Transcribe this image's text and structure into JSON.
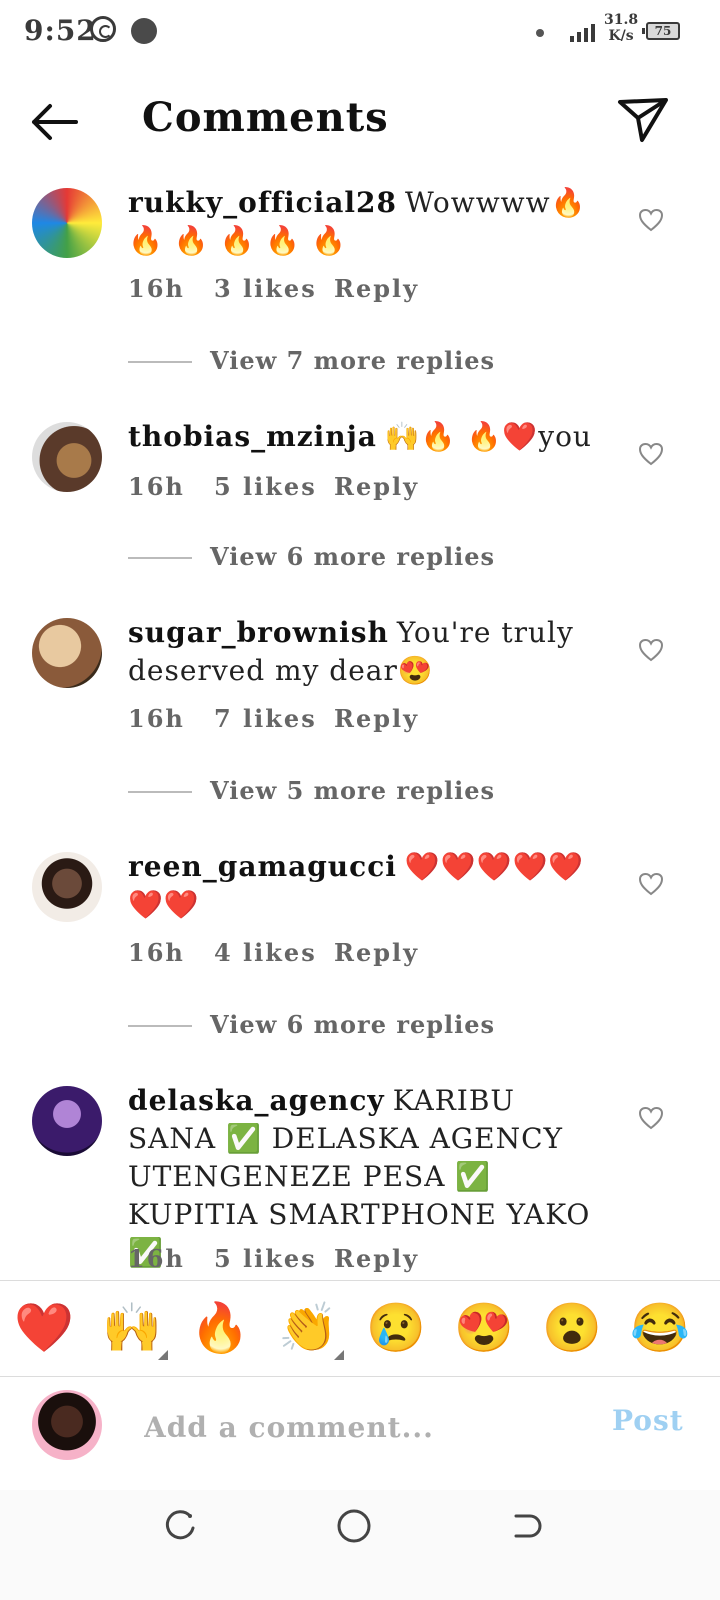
{
  "status_bar": {
    "time": "9:52",
    "speed_value": "31.8",
    "speed_unit": "K/s",
    "battery": "75"
  },
  "header": {
    "title": "Comments"
  },
  "comments": [
    {
      "username": "rukky_official28",
      "text": "Wowwww🔥 🔥 🔥 🔥 🔥 🔥",
      "time": "16h",
      "likes": "3 likes",
      "reply": "Reply",
      "view_replies": "View 7 more replies"
    },
    {
      "username": "thobias_mzinja",
      "text": "🙌🔥 🔥❤️you",
      "time": "16h",
      "likes": "5 likes",
      "reply": "Reply",
      "view_replies": "View 6 more replies"
    },
    {
      "username": "sugar_brownish",
      "text": "You're truly deserved my dear😍",
      "time": "16h",
      "likes": "7 likes",
      "reply": "Reply",
      "view_replies": "View 5 more replies"
    },
    {
      "username": "reen_gamagucci",
      "text": "❤️❤️❤️❤️❤️❤️❤️",
      "time": "16h",
      "likes": "4 likes",
      "reply": "Reply",
      "view_replies": "View 6 more replies"
    },
    {
      "username": "delaska_agency",
      "text": "KARIBU SANA ✅ DELASKA AGENCY UTENGENEZE PESA ✅ KUPITIA SMARTPHONE YAKO ✅",
      "time": "16h",
      "likes": "5 likes",
      "reply": "Reply"
    }
  ],
  "emoji_bar": [
    "❤️",
    "🙌",
    "🔥",
    "👏",
    "😢",
    "😍",
    "😮",
    "😂"
  ],
  "input": {
    "placeholder": "Add a comment...",
    "post_label": "Post"
  },
  "colors": {
    "post": "#9fd0f2",
    "meta": "#666666"
  },
  "icons": {
    "back": "arrow-left-icon",
    "share": "paper-plane-icon",
    "like": "heart-outline-icon",
    "nav_recents": "recents-icon",
    "nav_home": "home-circle-icon",
    "nav_back": "back-nav-icon"
  }
}
